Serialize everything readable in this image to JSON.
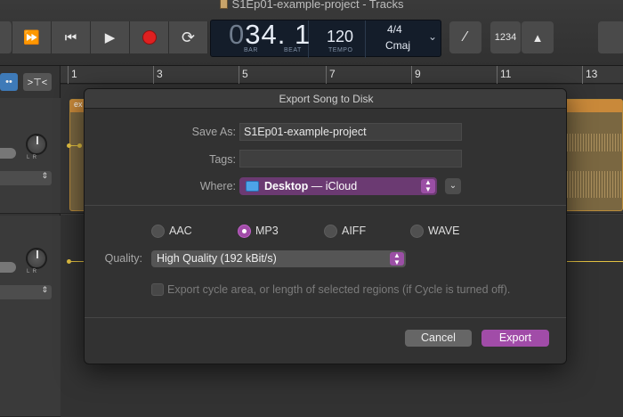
{
  "window": {
    "title": "S1Ep01-example-project - Tracks"
  },
  "toolbar": {
    "fast_forward_icon": "fast-forward-icon",
    "go_to_start_icon": "go-to-start-icon",
    "play_icon": "play-icon",
    "record_icon": "record-icon",
    "cycle_icon": "cycle-icon",
    "tuner_icon": "tuner-icon",
    "count_in_label": "1234",
    "metronome_icon": "metronome-icon"
  },
  "lcd": {
    "position_lead": "0",
    "position": "34. 1",
    "bar_label": "BAR",
    "beat_label": "BEAT",
    "tempo": "120",
    "tempo_label": "TEMPO",
    "time_signature": "4/4",
    "key": "Cmaj"
  },
  "ruler": {
    "bars": [
      "1",
      "3",
      "5",
      "7",
      "9",
      "11",
      "13"
    ]
  },
  "track_area": {
    "region_label": "ex"
  },
  "dialog": {
    "title": "Export Song to Disk",
    "save_as_label": "Save As:",
    "save_as_value": "S1Ep01-example-project",
    "tags_label": "Tags:",
    "tags_value": "",
    "where_label": "Where:",
    "where_folder": "Desktop",
    "where_location": " — iCloud",
    "formats": [
      {
        "label": "AAC",
        "selected": false
      },
      {
        "label": "MP3",
        "selected": true
      },
      {
        "label": "AIFF",
        "selected": false
      },
      {
        "label": "WAVE",
        "selected": false
      }
    ],
    "quality_label": "Quality:",
    "quality_value": "High Quality (192 kBit/s)",
    "cycle_checkbox_label": "Export cycle area, or length of selected regions (if Cycle is turned off).",
    "cycle_checkbox_checked": false,
    "cancel_label": "Cancel",
    "export_label": "Export"
  },
  "colors": {
    "accent": "#a14ca8",
    "record": "#e02020",
    "region": "#c9893a",
    "automation": "#e4c242",
    "lcd_background": "#141d2a"
  }
}
